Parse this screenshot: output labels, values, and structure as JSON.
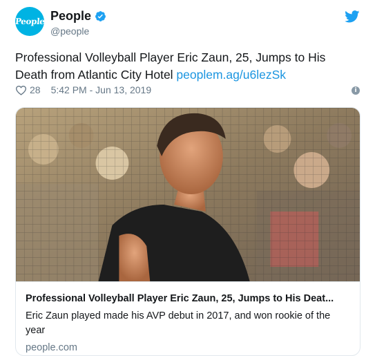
{
  "account": {
    "avatar_text": "People",
    "display_name": "People",
    "verified": true,
    "handle": "@people"
  },
  "tweet": {
    "text": "Professional Volleyball Player Eric Zaun, 25, Jumps to His Death from Atlantic City Hotel ",
    "link": "peoplem.ag/u6lezSk",
    "likes": "28",
    "timestamp": "5:42 PM - Jun 13, 2019"
  },
  "card": {
    "image_description": "photo",
    "title": "Professional Volleyball Player Eric Zaun, 25, Jumps to His Deat...",
    "description": "Eric Zaun played made his AVP debut in 2017, and won rookie of the year",
    "domain": "people.com"
  },
  "colors": {
    "brand": "#1da1f2",
    "link": "#1b95e0",
    "avatar": "#00b3e3",
    "secondary_text": "#657786"
  },
  "icons": [
    "verified-badge-icon",
    "twitter-bird-icon",
    "heart-icon",
    "info-icon"
  ]
}
